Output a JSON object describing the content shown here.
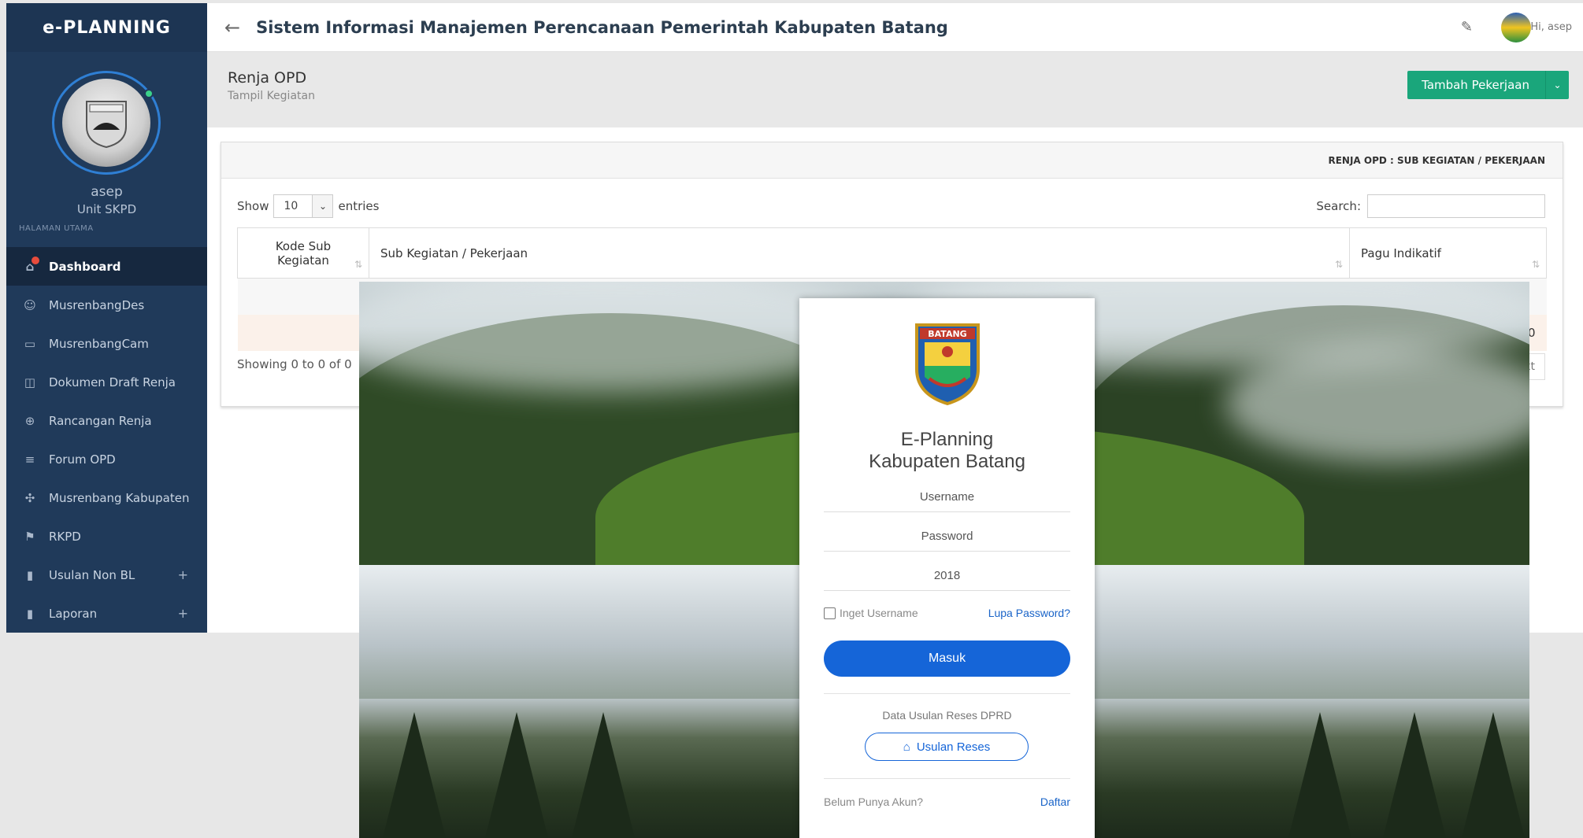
{
  "sidebar": {
    "brand": "e-PLANNING",
    "user_name": "asep",
    "user_role": "Unit SKPD",
    "section_label": "HALAMAN UTAMA",
    "items": [
      {
        "label": "Dashboard",
        "icon": "home-icon",
        "glyph": "⌂"
      },
      {
        "label": "MusrenbangDes",
        "icon": "user-icon",
        "glyph": "☺"
      },
      {
        "label": "MusrenbangCam",
        "icon": "desktop-icon",
        "glyph": "▭"
      },
      {
        "label": "Dokumen Draft Renja",
        "icon": "columns-icon",
        "glyph": "◫"
      },
      {
        "label": "Rancangan Renja",
        "icon": "target-icon",
        "glyph": "⊕"
      },
      {
        "label": "Forum OPD",
        "icon": "forum-icon",
        "glyph": "≡"
      },
      {
        "label": "Musrenbang Kabupaten",
        "icon": "move-icon",
        "glyph": "✣"
      },
      {
        "label": "RKPD",
        "icon": "flag-icon",
        "glyph": "⚑"
      },
      {
        "label": "Usulan Non BL",
        "icon": "chart-icon",
        "glyph": "▮",
        "plus": "+"
      },
      {
        "label": "Laporan",
        "icon": "chart-icon",
        "glyph": "▮",
        "plus": "+"
      }
    ]
  },
  "topbar": {
    "title": "Sistem Informasi Manajemen Perencanaan Pemerintah Kabupaten Batang",
    "greeting": "Hi, asep"
  },
  "page_header": {
    "title": "Renja OPD",
    "subtitle": "Tampil Kegiatan",
    "add_button": "Tambah Pekerjaan"
  },
  "panel": {
    "heading": "RENJA OPD : SUB KEGIATAN / PEKERJAAN",
    "show_label": "Show",
    "entries_value": "10",
    "entries_label": "entries",
    "search_label": "Search:",
    "columns": [
      "Kode Sub Kegiatan",
      "Sub Kegiatan / Pekerjaan",
      "Pagu Indikatif"
    ],
    "total_value": "0",
    "showing_text": "Showing 0 to 0 of 0",
    "next_label": "xt"
  },
  "login": {
    "title_line1": "E-Planning",
    "title_line2": "Kabupaten Batang",
    "crest_text": "BATANG",
    "username_placeholder": "Username",
    "password_placeholder": "Password",
    "year_value": "2018",
    "remember_label": "Inget Username",
    "forgot_link": "Lupa Password?",
    "submit_label": "Masuk",
    "reses_label": "Data Usulan Reses DPRD",
    "reses_button": "Usulan Reses",
    "no_account_label": "Belum Punya Akun?",
    "register_link": "Daftar"
  },
  "colors": {
    "sidebar_bg": "#203a5a",
    "accent_green": "#1aa67b",
    "primary_blue": "#1565d8"
  }
}
